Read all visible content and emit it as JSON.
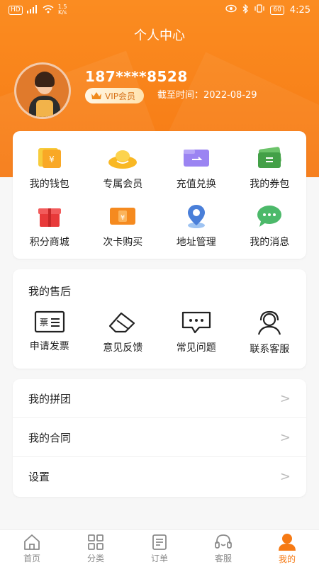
{
  "status_bar": {
    "hd": "HD",
    "signal": "⁴ᴳ",
    "speed_top": "1.5",
    "speed_bottom": "K/s",
    "battery": "60",
    "time": "4:25"
  },
  "page_title": "个人中心",
  "user": {
    "phone": "187****8528",
    "vip_label": "VIP会员",
    "expire_label": "截至时间：",
    "expire_date": "2022-08-29"
  },
  "features": [
    {
      "label": "我的钱包",
      "icon": "wallet-icon"
    },
    {
      "label": "专属会员",
      "icon": "gold-ingot-icon"
    },
    {
      "label": "充值兑换",
      "icon": "recharge-icon"
    },
    {
      "label": "我的券包",
      "icon": "coupon-icon"
    },
    {
      "label": "积分商城",
      "icon": "gift-icon"
    },
    {
      "label": "次卡购买",
      "icon": "card-icon"
    },
    {
      "label": "地址管理",
      "icon": "location-icon"
    },
    {
      "label": "我的消息",
      "icon": "message-icon"
    }
  ],
  "after_sales": {
    "title": "我的售后",
    "items": [
      {
        "label": "申请发票",
        "icon": "invoice-icon",
        "icon_text": "票"
      },
      {
        "label": "意见反馈",
        "icon": "eraser-icon"
      },
      {
        "label": "常见问题",
        "icon": "chat-bubble-icon"
      },
      {
        "label": "联系客服",
        "icon": "headset-icon"
      }
    ]
  },
  "menu": [
    {
      "label": "我的拼团"
    },
    {
      "label": "我的合同"
    },
    {
      "label": "设置"
    }
  ],
  "tabs": [
    {
      "label": "首页",
      "icon": "home-icon"
    },
    {
      "label": "分类",
      "icon": "category-icon"
    },
    {
      "label": "订单",
      "icon": "order-icon"
    },
    {
      "label": "客服",
      "icon": "service-icon"
    },
    {
      "label": "我的",
      "icon": "profile-icon",
      "active": true
    }
  ],
  "colors": {
    "accent": "#f67a14",
    "vip_text": "#d8731a"
  }
}
